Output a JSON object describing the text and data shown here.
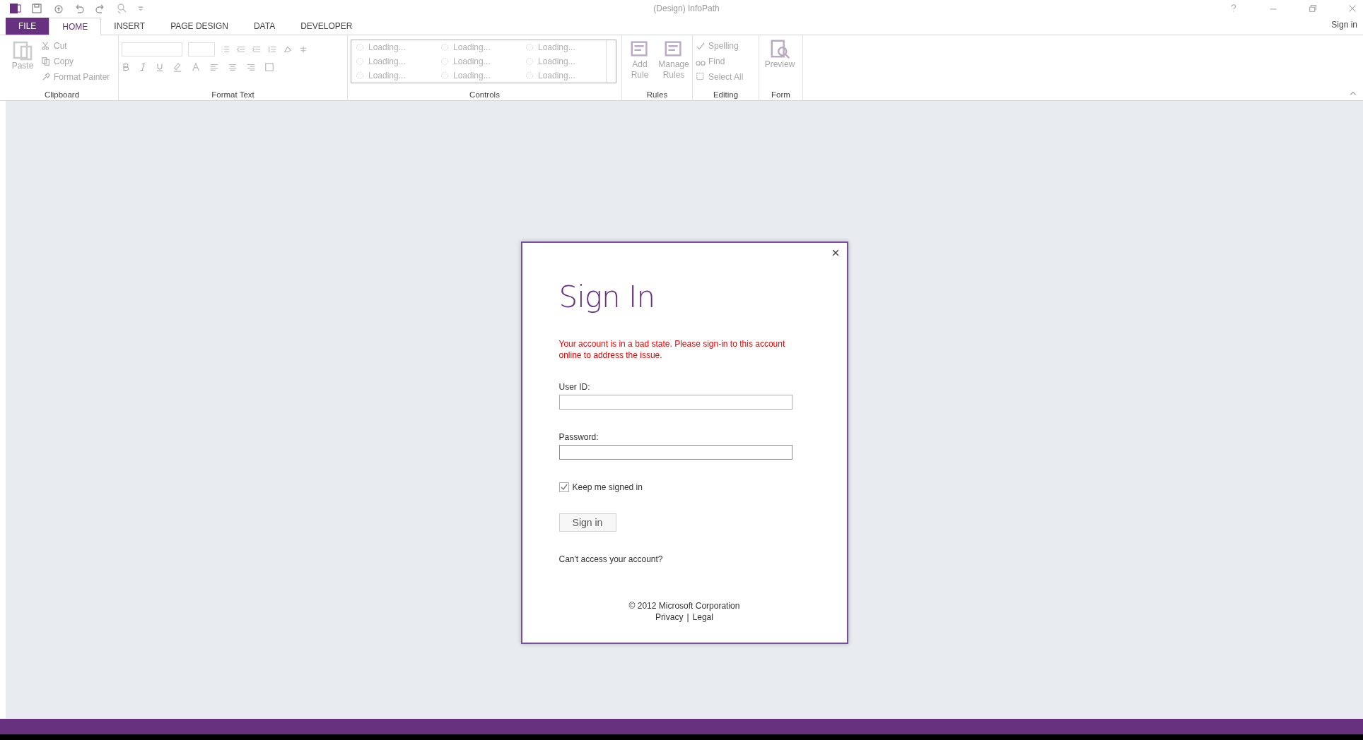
{
  "window": {
    "title": "(Design) InfoPath"
  },
  "tabs": [
    {
      "label": "FILE",
      "kind": "file",
      "selected": false
    },
    {
      "label": "HOME",
      "kind": "tab",
      "selected": true
    },
    {
      "label": "INSERT",
      "kind": "tab",
      "selected": false
    },
    {
      "label": "PAGE DESIGN",
      "kind": "tab",
      "selected": false
    },
    {
      "label": "DATA",
      "kind": "tab",
      "selected": false
    },
    {
      "label": "DEVELOPER",
      "kind": "tab",
      "selected": false
    }
  ],
  "account": {
    "label": "Sign in"
  },
  "ribbon": {
    "clipboard": {
      "title": "Clipboard",
      "paste": {
        "label": "Paste",
        "disabled": true
      },
      "items": [
        {
          "label": "Cut",
          "disabled": true
        },
        {
          "label": "Copy",
          "disabled": true
        },
        {
          "label": "Format Painter",
          "disabled": true
        }
      ]
    },
    "format_text": {
      "title": "Format Text"
    },
    "controls": {
      "title": "Controls",
      "items": [
        "Loading...",
        "Loading...",
        "Loading...",
        "Loading...",
        "Loading...",
        "Loading...",
        "Loading...",
        "Loading...",
        "Loading..."
      ]
    },
    "rules": {
      "title": "Rules",
      "items": [
        {
          "label": "Add Rule",
          "disabled": true
        },
        {
          "label": "Manage Rules",
          "disabled": true
        }
      ]
    },
    "editing": {
      "title": "Editing",
      "items": [
        {
          "label": "Spelling",
          "disabled": true
        },
        {
          "label": "Find",
          "disabled": true
        },
        {
          "label": "Select All",
          "disabled": true
        }
      ]
    },
    "form": {
      "title": "Form",
      "items": [
        {
          "label": "Preview",
          "disabled": true
        }
      ]
    }
  },
  "dialog": {
    "title": "Sign In",
    "error": "Your account is in a bad state. Please sign-in to this account online to address the issue.",
    "fields": [
      {
        "label": "User ID:",
        "focused": false
      },
      {
        "label": "Password:",
        "focused": true
      }
    ],
    "keep_signed_in": {
      "label": "Keep me signed in",
      "checked": true
    },
    "button": "Sign in",
    "help_link": "Can't access your account?",
    "copyright": "© 2012 Microsoft Corporation",
    "links": [
      "Privacy",
      "Legal"
    ],
    "link_separator": "|"
  }
}
